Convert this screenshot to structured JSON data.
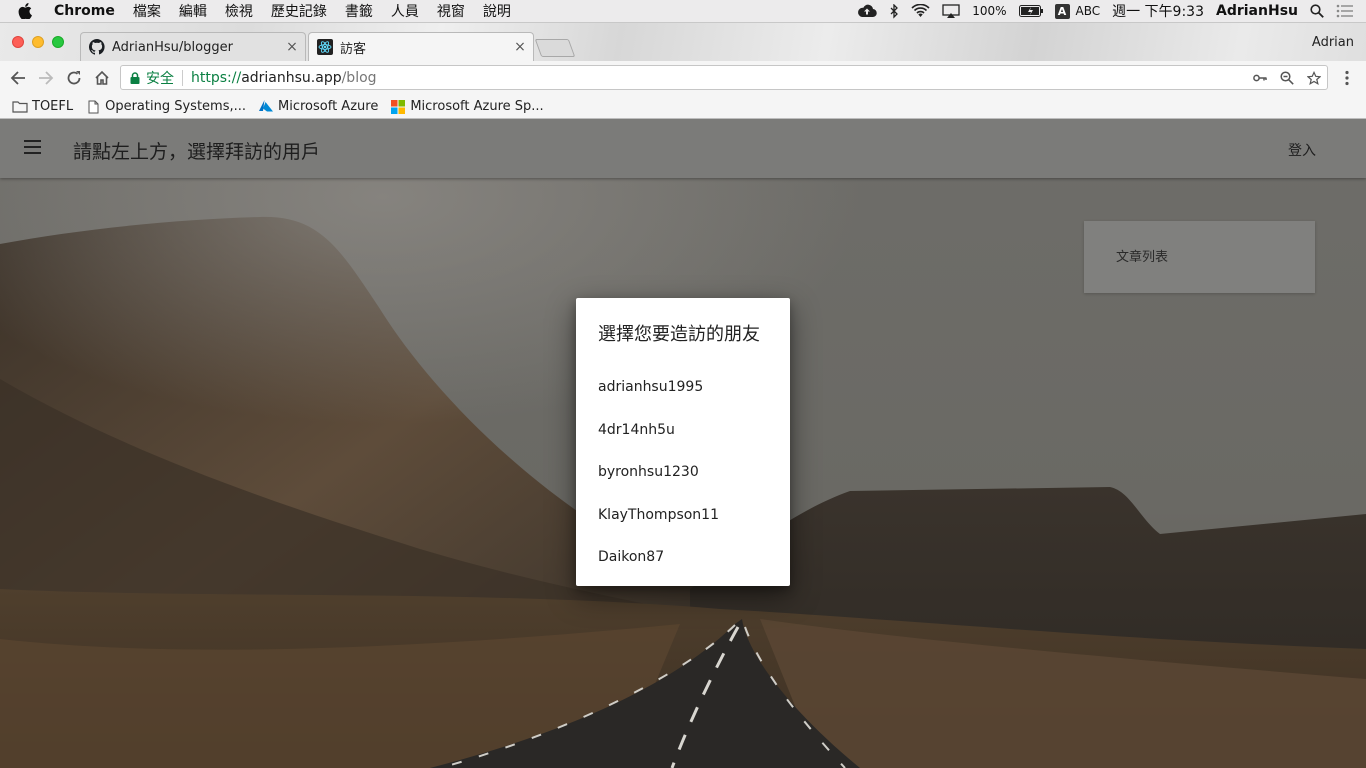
{
  "menubar": {
    "app_name": "Chrome",
    "items": [
      "檔案",
      "編輯",
      "檢視",
      "歷史記錄",
      "書籤",
      "人員",
      "視窗",
      "說明"
    ],
    "battery": "100%",
    "input_mode_letter": "A",
    "input_mode": "ABC",
    "clock": "週一 下午9:33",
    "user": "AdrianHsu"
  },
  "browser": {
    "tabs": [
      {
        "title": "AdrianHsu/blogger",
        "icon": "github-icon"
      },
      {
        "title": "訪客",
        "icon": "react-icon"
      }
    ],
    "tab_close": "×",
    "profile": "Adrian",
    "address": {
      "secure_label": "安全",
      "scheme": "https://",
      "host": "adrianhsu.app",
      "path": "/blog"
    },
    "bookmarks": [
      {
        "label": "TOEFL",
        "icon": "folder-icon"
      },
      {
        "label": "Operating Systems,...",
        "icon": "page-icon"
      },
      {
        "label": "Microsoft Azure",
        "icon": "azure-icon"
      },
      {
        "label": "Microsoft Azure Sp...",
        "icon": "microsoft-icon"
      }
    ]
  },
  "app": {
    "title": "請點左上方，選擇拜訪的用戶",
    "login": "登入",
    "sidebar_card": "文章列表"
  },
  "dialog": {
    "title": "選擇您要造訪的朋友",
    "users": [
      "adrianhsu1995",
      "4dr14nh5u",
      "byronhsu1230",
      "KlayThompson11",
      "Daikon87"
    ]
  }
}
